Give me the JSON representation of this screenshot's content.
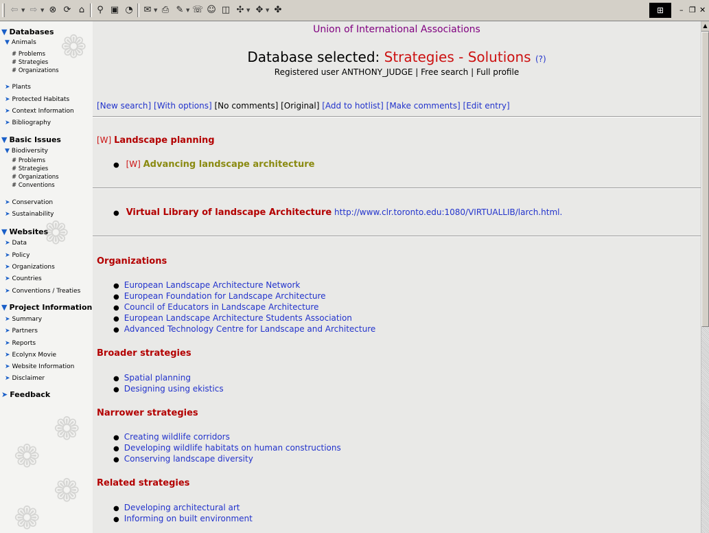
{
  "toolbar": {
    "buttons": [
      "back-icon",
      "forward-icon",
      "stop-icon",
      "refresh-icon",
      "home-icon",
      "search-icon",
      "favorites-icon",
      "history-icon",
      "mail-icon",
      "print-icon",
      "edit-icon",
      "discuss-icon",
      "messenger-icon",
      "window-icon",
      "translate-icon",
      "encoding-icon",
      "tools-icon"
    ],
    "window_controls": [
      "minimize",
      "restore",
      "close"
    ]
  },
  "sidebar": {
    "sections": [
      {
        "label": "Databases",
        "items": [
          {
            "label": "Animals",
            "expanded": true,
            "children": [
              "# Problems",
              "# Strategies",
              "# Organizations"
            ]
          },
          {
            "label": "Plants"
          },
          {
            "label": "Protected Habitats"
          },
          {
            "label": "Context Information"
          },
          {
            "label": "Bibliography"
          }
        ]
      },
      {
        "label": "Basic Issues",
        "items": [
          {
            "label": "Biodiversity",
            "expanded": true,
            "children": [
              "# Problems",
              "# Strategies",
              "# Organizations",
              "# Conventions"
            ]
          },
          {
            "label": "Conservation"
          },
          {
            "label": "Sustainability"
          }
        ]
      },
      {
        "label": "Websites",
        "items": [
          {
            "label": "Data"
          },
          {
            "label": "Policy"
          },
          {
            "label": "Organizations"
          },
          {
            "label": "Countries"
          },
          {
            "label": "Conventions / Treaties"
          }
        ]
      },
      {
        "label": "Project Information",
        "items": [
          {
            "label": "Summary"
          },
          {
            "label": "Partners"
          },
          {
            "label": "Reports"
          },
          {
            "label": "Ecolynx Movie"
          },
          {
            "label": "Website Information"
          },
          {
            "label": "Disclaimer"
          }
        ]
      },
      {
        "label": "Feedback",
        "items": []
      }
    ]
  },
  "header": {
    "org_name": "Union of International Associations",
    "db_prefix": "Database selected: ",
    "db_name": "Strategies - Solutions",
    "help": "(?)",
    "user_line": "Registered user ANTHONY_JUDGE | Free search | Full profile"
  },
  "actions": {
    "new_search": "[New search]",
    "with_options": "[With options]",
    "no_comments": "[No comments]",
    "original": "[Original]",
    "add_hotlist": "[Add to hotlist]",
    "make_comments": "[Make comments]",
    "edit_entry": "[Edit entry]"
  },
  "entry": {
    "w_tag": "[W]",
    "title": "Landscape planning",
    "sub_w_tag": "[W]",
    "sub_title": "Advancing landscape architecture",
    "library_label": "Virtual Library of landscape Architecture",
    "library_url": "http://www.clr.toronto.edu:1080/VIRTUALLIB/larch.html",
    "library_suffix": "."
  },
  "sections": [
    {
      "heading": "Organizations",
      "items": [
        "European Landscape Architecture Network",
        "European Foundation for Landscape Architecture",
        "Council of Educators in Landscape Architecture",
        "European Landscape Architecture Students Association",
        "Advanced Technology Centre for Landscape and Architecture"
      ]
    },
    {
      "heading": "Broader strategies",
      "items": [
        "Spatial planning",
        "Designing using ekistics"
      ]
    },
    {
      "heading": "Narrower strategies",
      "items": [
        "Creating wildlife corridors",
        "Developing wildlife habitats on human constructions",
        "Conserving landscape diversity"
      ]
    },
    {
      "heading": "Related strategies",
      "items": [
        "Developing architectural art",
        "Informing on built environment"
      ]
    }
  ],
  "colors": {
    "link": "#2233cc",
    "heading": "#b30000",
    "db_name": "#dd1111",
    "subtitle": "#8a8a10",
    "chevron": "#1a5fc8"
  }
}
